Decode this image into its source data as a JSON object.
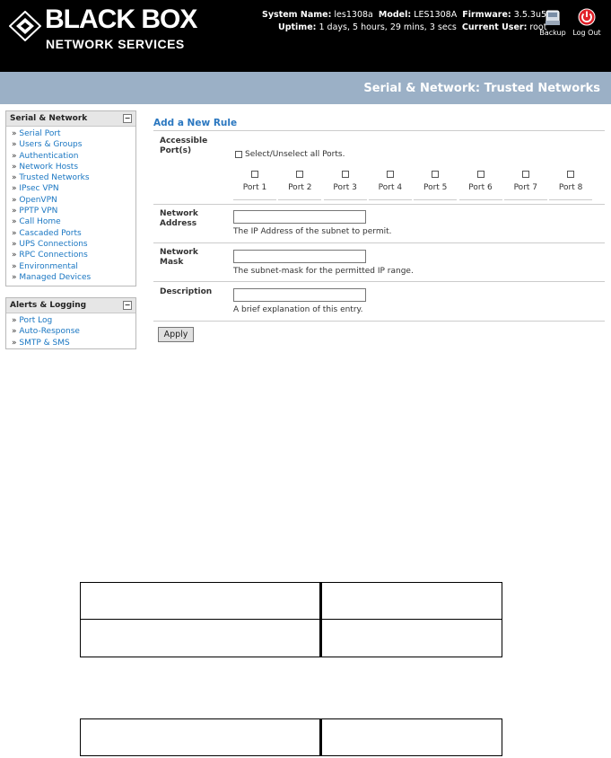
{
  "brand": {
    "name": "BLACK BOX",
    "sub": "NETWORK SERVICES"
  },
  "system": {
    "name_label": "System Name:",
    "name_value": "les1308a",
    "model_label": "Model:",
    "model_value": "LES1308A",
    "firmware_label": "Firmware:",
    "firmware_value": "3.5.3u5",
    "uptime_label": "Uptime:",
    "uptime_value": "1 days, 5 hours, 29 mins, 3 secs",
    "user_label": "Current User:",
    "user_value": "root"
  },
  "header_buttons": {
    "backup": "Backup",
    "logout": "Log Out"
  },
  "page_title": "Serial & Network: Trusted Networks",
  "sidebar": {
    "section1": {
      "title": "Serial & Network",
      "collapse": "−",
      "items": [
        "Serial Port",
        "Users & Groups",
        "Authentication",
        "Network Hosts",
        "Trusted Networks",
        "IPsec VPN",
        "OpenVPN",
        "PPTP VPN",
        "Call Home",
        "Cascaded Ports",
        "UPS Connections",
        "RPC Connections",
        "Environmental",
        "Managed Devices"
      ]
    },
    "section2": {
      "title": "Alerts & Logging",
      "collapse": "−",
      "items": [
        "Port Log",
        "Auto-Response",
        "SMTP & SMS"
      ]
    },
    "arrow": "»"
  },
  "form": {
    "title": "Add a New Rule",
    "ports_label_1": "Accessible",
    "ports_label_2": "Port(s)",
    "select_all": "Select/Unselect all Ports.",
    "ports": [
      "Port 1",
      "Port 2",
      "Port 3",
      "Port 4",
      "Port 5",
      "Port 6",
      "Port 7",
      "Port 8"
    ],
    "address_label_1": "Network",
    "address_label_2": "Address",
    "address_value": "",
    "address_hint": "The IP Address of the subnet to permit.",
    "mask_label_1": "Network",
    "mask_label_2": "Mask",
    "mask_value": "",
    "mask_hint": "The subnet-mask for the permitted IP range.",
    "desc_label": "Description",
    "desc_value": "",
    "desc_hint": "A brief explanation of this entry.",
    "apply": "Apply"
  },
  "colors": {
    "header_bg": "#000000",
    "title_bar": "#9bb0c6",
    "link": "#1976c2",
    "form_title": "#2a77c0"
  }
}
